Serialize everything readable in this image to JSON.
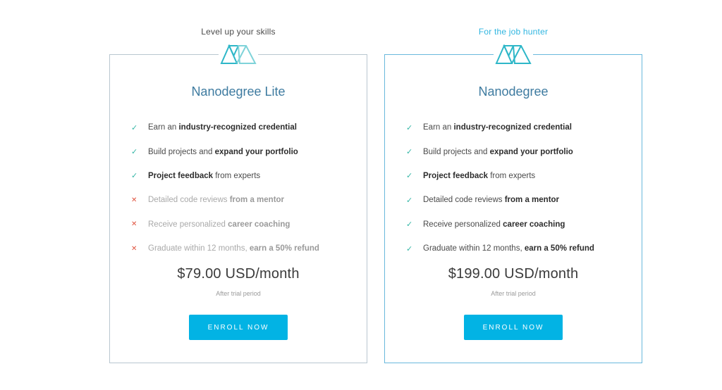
{
  "plans": [
    {
      "tagline": "Level up your skills",
      "title": "Nanodegree Lite",
      "features": [
        {
          "included": true,
          "pre": "Earn an ",
          "bold": "industry-recognized credential",
          "post": ""
        },
        {
          "included": true,
          "pre": "Build projects and ",
          "bold": "expand your portfolio",
          "post": ""
        },
        {
          "included": true,
          "pre": "",
          "bold": "Project feedback",
          "post": " from experts"
        },
        {
          "included": false,
          "pre": "Detailed code reviews ",
          "bold": "from a mentor",
          "post": ""
        },
        {
          "included": false,
          "pre": "Receive personalized ",
          "bold": "career coaching",
          "post": ""
        },
        {
          "included": false,
          "pre": "Graduate within 12 months, ",
          "bold": "earn a 50% refund",
          "post": ""
        }
      ],
      "price": "$79.00 USD/month",
      "price_note": "After trial period",
      "button_label": "ENROLL NOW"
    },
    {
      "tagline": "For the job hunter",
      "title": "Nanodegree",
      "features": [
        {
          "included": true,
          "pre": "Earn an ",
          "bold": "industry-recognized credential",
          "post": ""
        },
        {
          "included": true,
          "pre": "Build projects and ",
          "bold": "expand your portfolio",
          "post": ""
        },
        {
          "included": true,
          "pre": "",
          "bold": "Project feedback",
          "post": " from experts"
        },
        {
          "included": true,
          "pre": "Detailed code reviews ",
          "bold": "from a mentor",
          "post": ""
        },
        {
          "included": true,
          "pre": "Receive personalized ",
          "bold": "career coaching",
          "post": ""
        },
        {
          "included": true,
          "pre": "Graduate within 12 months, ",
          "bold": "earn a 50% refund",
          "post": ""
        }
      ],
      "price": "$199.00 USD/month",
      "price_note": "After trial period",
      "button_label": "ENROLL NOW"
    }
  ],
  "icons": {
    "included": "✓",
    "excluded": "✕",
    "logo": "nanodegree-logo-icon"
  },
  "colors": {
    "accent": "#02b3e4",
    "title": "#3e7ba0",
    "check": "#34b6a6",
    "cross": "#e0533f",
    "highlight_tagline": "#2fb5e0",
    "logo_light": "#7fd3d9",
    "logo_dark": "#2eb7c8"
  }
}
